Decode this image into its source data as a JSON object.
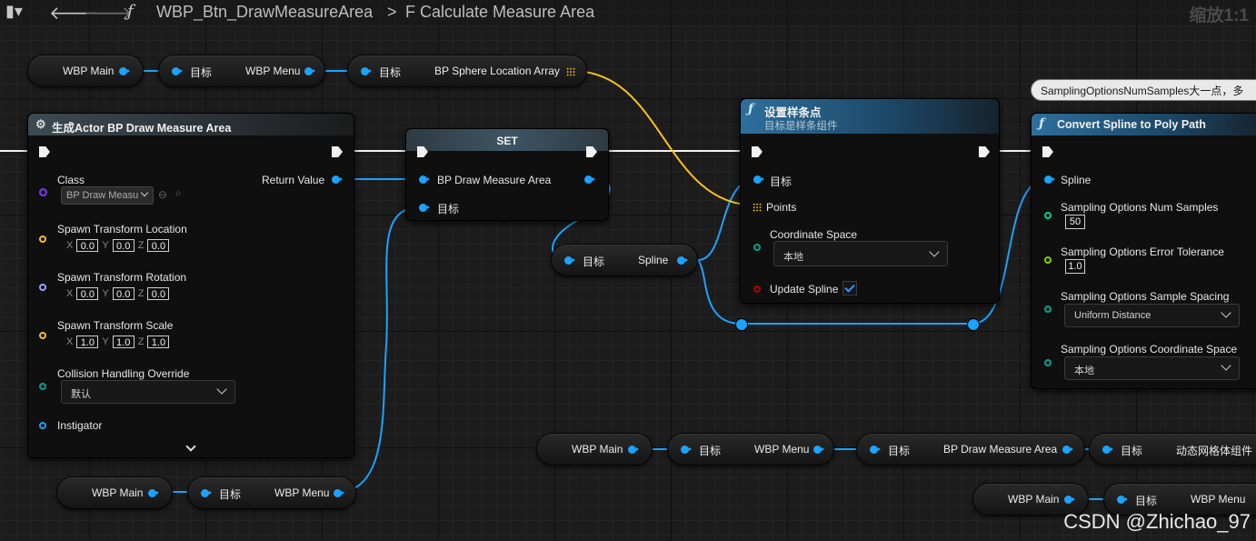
{
  "toolbar": {
    "breadcrumb_root": "WBP_Btn_DrawMeasureArea",
    "breadcrumb_sep": ">",
    "breadcrumb_current": "F Calculate Measure Area",
    "zoom": "缩放1:1",
    "icons": [
      "bookmark-icon",
      "back-arrow-icon",
      "forward-arrow-icon",
      "function-icon"
    ]
  },
  "pills": {
    "wbp_main": "WBP Main",
    "target": "目标",
    "wbp_menu": "WBP Menu",
    "bp_sphere_location_array": "BP Sphere Location Array",
    "spline": "Spline",
    "bp_draw_measure_area": "BP Draw Measure Area",
    "dynamic_mesh_component": "动态网格体组件"
  },
  "spawn_node": {
    "title": "生成Actor BP Draw Measure Area",
    "class_label": "Class",
    "class_value": "BP Draw Measu",
    "return_value": "Return Value",
    "location_label": "Spawn Transform Location",
    "rotation_label": "Spawn Transform Rotation",
    "scale_label": "Spawn Transform Scale",
    "axis_x": "X",
    "axis_y": "Y",
    "axis_z": "Z",
    "loc": [
      "0.0",
      "0.0",
      "0.0"
    ],
    "rot": [
      "0.0",
      "0.0",
      "0.0"
    ],
    "scl": [
      "1.0",
      "1.0",
      "1.0"
    ],
    "collision_label": "Collision Handling Override",
    "collision_value": "默认",
    "instigator_label": "Instigator"
  },
  "set_node": {
    "title": "SET",
    "pin_value": "BP Draw Measure Area",
    "pin_target": "目标"
  },
  "set_points_node": {
    "title": "设置样条点",
    "subtitle": "目标是样条组件",
    "pin_target": "目标",
    "pin_points": "Points",
    "coord_label": "Coordinate Space",
    "coord_value": "本地",
    "update_label": "Update Spline",
    "update_checked": true
  },
  "convert_node": {
    "title": "Convert Spline to Poly Path",
    "tooltip": "SamplingOptionsNumSamples大一点，多",
    "pin_spline": "Spline",
    "num_samples_label": "Sampling Options Num Samples",
    "num_samples_value": "50",
    "error_tol_label": "Sampling Options Error Tolerance",
    "error_tol_value": "1.0",
    "spacing_label": "Sampling Options Sample Spacing",
    "spacing_value": "Uniform Distance",
    "coord_label": "Sampling Options Coordinate Space",
    "coord_value": "本地"
  },
  "watermark": "CSDN @Zhichao_97",
  "colors": {
    "object_pin": "#1aa3ff",
    "array_wire": "#f6c21a",
    "exec": "#f2f2f2"
  }
}
